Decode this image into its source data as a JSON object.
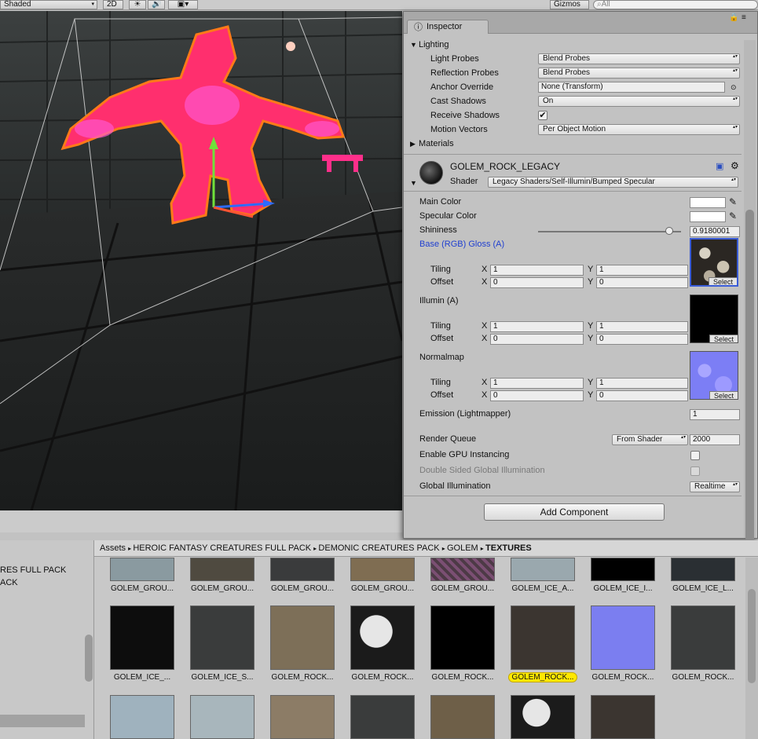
{
  "toolbar": {
    "shading_mode": "Shaded",
    "mode_2d": "2D",
    "gizmos": "Gizmos",
    "search_placeholder": "All"
  },
  "inspector": {
    "tab_label": "Inspector",
    "lighting_section": "Lighting",
    "rows": {
      "light_probes": {
        "label": "Light Probes",
        "value": "Blend Probes"
      },
      "reflection_probes": {
        "label": "Reflection Probes",
        "value": "Blend Probes"
      },
      "anchor_override": {
        "label": "Anchor Override",
        "value": "None (Transform)"
      },
      "cast_shadows": {
        "label": "Cast Shadows",
        "value": "On"
      },
      "receive_shadows": {
        "label": "Receive Shadows",
        "checked": true
      },
      "motion_vectors": {
        "label": "Motion Vectors",
        "value": "Per Object Motion"
      }
    },
    "materials_section": "Materials",
    "material": {
      "name": "GOLEM_ROCK_LEGACY",
      "shader_label": "Shader",
      "shader_value": "Legacy Shaders/Self-Illumin/Bumped Specular"
    },
    "props": {
      "main_color": "Main Color",
      "specular_color": "Specular Color",
      "shininess": "Shininess",
      "shininess_value": "0.9180001",
      "shininess_level": 0.918,
      "base_label": "Base (RGB) Gloss (A)",
      "illum_label": "Illumin (A)",
      "normalmap_label": "Normalmap",
      "tiling": "Tiling",
      "offset": "Offset",
      "x": "X",
      "y": "Y",
      "one": "1",
      "zero": "0",
      "select": "Select",
      "emission_label": "Emission (Lightmapper)",
      "emission_value": "1",
      "render_queue_label": "Render Queue",
      "render_queue_mode": "From Shader",
      "render_queue_value": "2000",
      "gpu_instancing": "Enable GPU Instancing",
      "double_sided_gi": "Double Sided Global Illumination",
      "global_illumination": "Global Illumination",
      "gi_value": "Realtime"
    },
    "add_component": "Add Component",
    "colors": {
      "link_blue": "#1f3fd0",
      "selected_frame": "#3a5cd6"
    }
  },
  "project": {
    "left_items": [
      "RES FULL PACK",
      "ACK"
    ],
    "breadcrumb": [
      "Assets",
      "HEROIC FANTASY CREATURES FULL PACK",
      "DEMONIC CREATURES PACK",
      "GOLEM",
      "TEXTURES"
    ],
    "row1": [
      "GOLEM_GROU...",
      "GOLEM_GROU...",
      "GOLEM_GROU...",
      "GOLEM_GROU...",
      "GOLEM_GROU...",
      "GOLEM_ICE_A...",
      "GOLEM_ICE_I...",
      "GOLEM_ICE_L..."
    ],
    "row2": [
      "GOLEM_ICE_...",
      "GOLEM_ICE_S...",
      "GOLEM_ROCK...",
      "GOLEM_ROCK...",
      "GOLEM_ROCK...",
      "GOLEM_ROCK...",
      "GOLEM_ROCK...",
      "GOLEM_ROCK..."
    ],
    "highlight_color": "#ffe800"
  }
}
